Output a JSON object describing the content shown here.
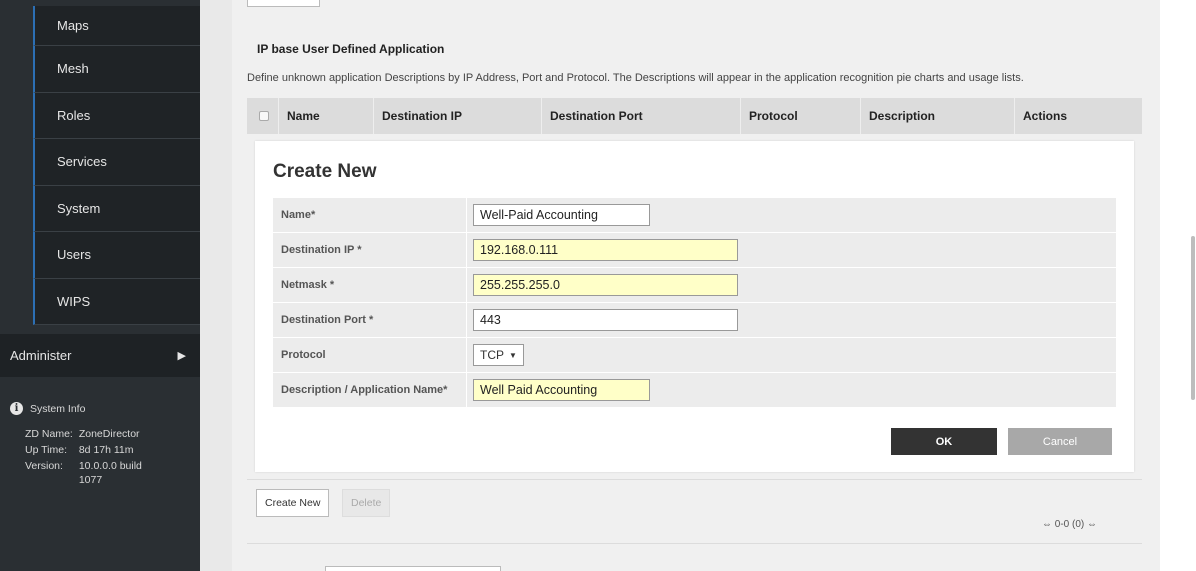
{
  "sidebar": {
    "items": [
      {
        "label": "Maps"
      },
      {
        "label": "Mesh"
      },
      {
        "label": "Roles"
      },
      {
        "label": "Services"
      },
      {
        "label": "System"
      },
      {
        "label": "Users"
      },
      {
        "label": "WIPS"
      }
    ],
    "administer": {
      "label": "Administer",
      "arrow": "▶"
    },
    "system_info": {
      "title": "System Info",
      "rows": [
        {
          "key": "ZD Name:",
          "value": "ZoneDirector"
        },
        {
          "key": "Up Time:",
          "value": "8d 17h 11m"
        },
        {
          "key": "Version:",
          "value": "10.0.0.0 build 1077"
        }
      ]
    }
  },
  "section": {
    "title": "IP base User Defined Application",
    "description": "Define unknown application Descriptions by IP Address, Port and Protocol. The Descriptions will appear in the application recognition pie charts and usage lists."
  },
  "grid": {
    "columns": [
      "Name",
      "Destination IP",
      "Destination Port",
      "Protocol",
      "Description",
      "Actions"
    ]
  },
  "dialog": {
    "title": "Create New",
    "fields": [
      {
        "label": "Name*",
        "value": "Well-Paid Accounting"
      },
      {
        "label": "Destination IP *",
        "value": "192.168.0.111"
      },
      {
        "label": "Netmask *",
        "value": "255.255.255.0"
      },
      {
        "label": "Destination Port *",
        "value": "443"
      },
      {
        "label": "Protocol",
        "value": "TCP"
      },
      {
        "label": "Description / Application Name*",
        "value": "Well Paid Accounting"
      }
    ],
    "ok_label": "OK",
    "cancel_label": "Cancel"
  },
  "actions": {
    "create_label": "Create New",
    "delete_label": "Delete"
  },
  "pager": {
    "text": "0-0 (0)"
  }
}
